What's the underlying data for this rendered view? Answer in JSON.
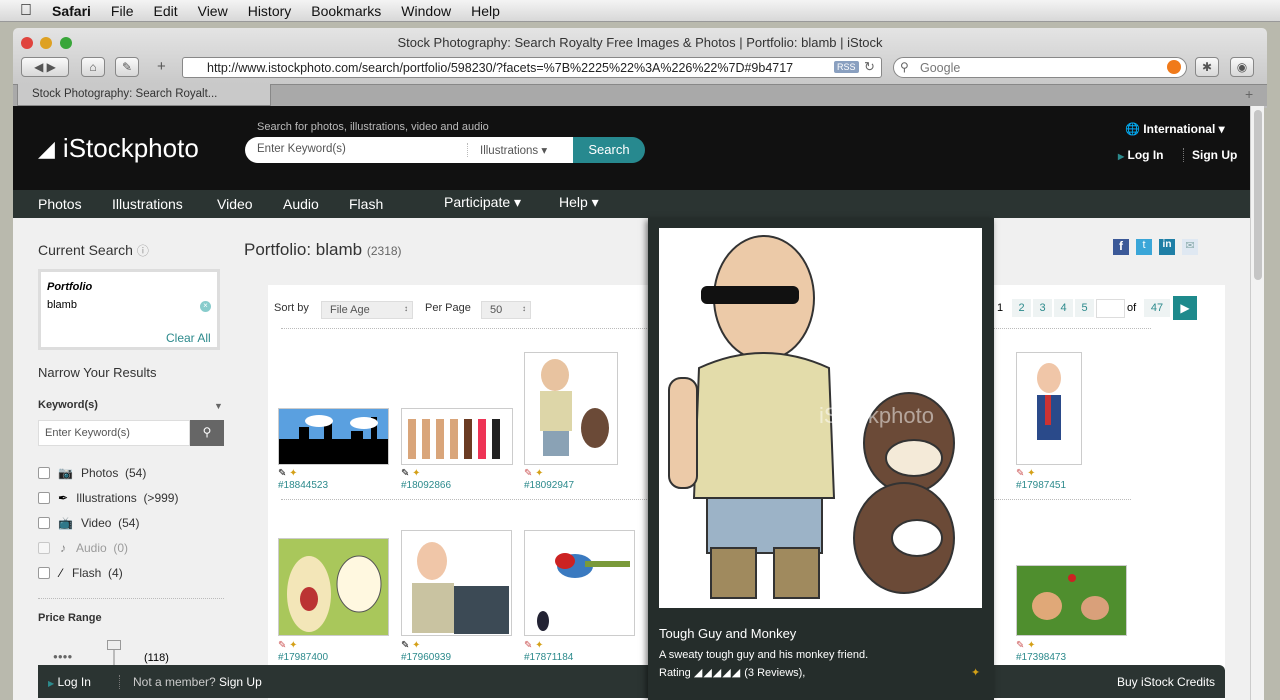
{
  "menubar": {
    "items": [
      "Safari",
      "File",
      "Edit",
      "View",
      "History",
      "Bookmarks",
      "Window",
      "Help"
    ]
  },
  "browser": {
    "title": "Stock Photography: Search Royalty Free Images & Photos | Portfolio: blamb | iStock",
    "url": "http://www.istockphoto.com/search/portfolio/598230/?facets=%7B%2225%22%3A%226%22%7D#9b4717",
    "rss": "RSS",
    "search_placeholder": "Google",
    "tab_label": "Stock Photography: Search Royalt...",
    "new_tab": "+"
  },
  "header": {
    "logo": "iStockphoto",
    "search_hint": "Search for photos, illustrations, video and audio",
    "search_placeholder": "Enter Keyword(s)",
    "category": "Illustrations",
    "search_button": "Search",
    "international": "International",
    "login": "Log In",
    "signup": "Sign Up"
  },
  "nav": {
    "items": [
      "Photos",
      "Illustrations",
      "Video",
      "Audio",
      "Flash"
    ],
    "participate": "Participate",
    "help": "Help"
  },
  "sidebar": {
    "current_search": "Current Search",
    "facet_label": "Portfolio",
    "facet_value": "blamb",
    "clear_all": "Clear All",
    "narrow": "Narrow Your Results",
    "keywords_label": "Keyword(s)",
    "keyword_placeholder": "Enter Keyword(s)",
    "filters": [
      {
        "label": "Photos",
        "count": "(54)"
      },
      {
        "label": "Illustrations",
        "count": "(>999)"
      },
      {
        "label": "Video",
        "count": "(54)"
      },
      {
        "label": "Audio",
        "count": "(0)"
      },
      {
        "label": "Flash",
        "count": "(4)"
      }
    ],
    "price_range": "Price Range",
    "price_count": "(118)"
  },
  "main": {
    "title": "Portfolio: blamb",
    "count": "(2318)",
    "sort_label": "Sort by",
    "sort_value": "File Age",
    "per_page_label": "Per Page",
    "per_page_value": "50",
    "pagination": {
      "current": "1",
      "pages": [
        "2",
        "3",
        "4",
        "5"
      ],
      "of": "of",
      "total": "47"
    },
    "row1_ids": [
      "#18844523",
      "#18092866",
      "#18092947",
      "#17987451"
    ],
    "row2_ids": [
      "#17987400",
      "#17960939",
      "#17871184",
      "#17398473"
    ]
  },
  "popup": {
    "title": "Tough Guy and Monkey",
    "description": "A sweaty tough guy and his monkey friend.",
    "rating_label": "Rating",
    "reviews": "(3 Reviews),",
    "watermark": "iStockphoto"
  },
  "bottombar": {
    "login": "Log In",
    "not_member": "Not a member?",
    "signup": "Sign Up",
    "buy": "Buy iStock Credits"
  },
  "colors": {
    "accent": "#2c8a8c",
    "header": "#111111",
    "nav": "#2b3432"
  }
}
